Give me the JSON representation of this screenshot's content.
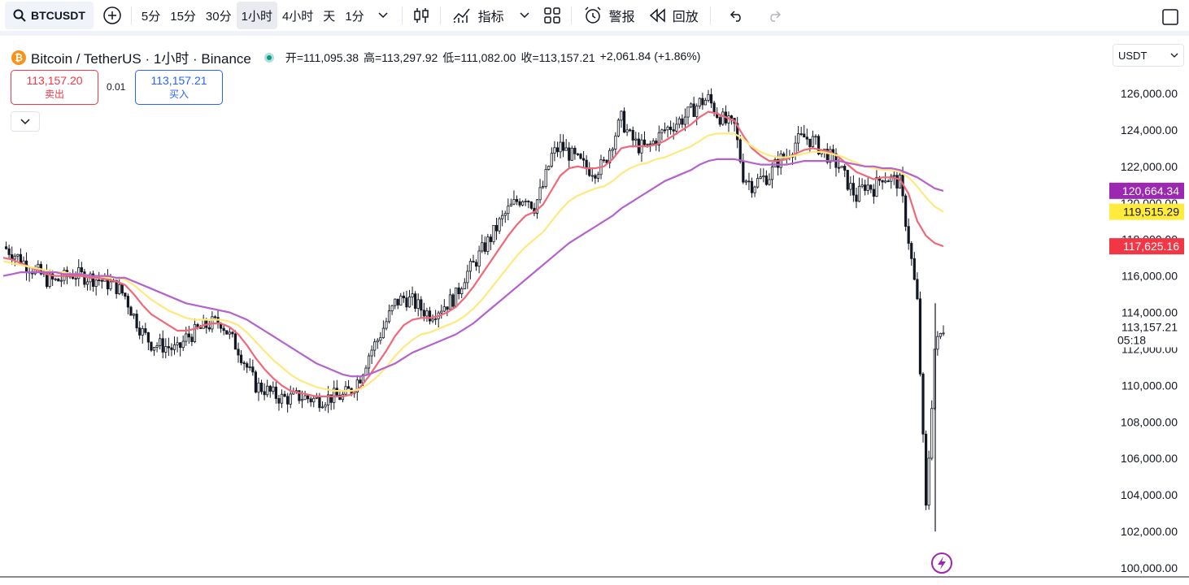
{
  "toolbar": {
    "symbol": "BTCUSDT",
    "timeframes": [
      "5分",
      "15分",
      "30分",
      "1小时",
      "4小时",
      "天",
      "1分"
    ],
    "active_timeframe": "1小时",
    "indicators_label": "指标",
    "alerts_label": "警报",
    "replay_label": "回放"
  },
  "legend": {
    "pair": "Bitcoin / TetherUS · 1小时 · Binance",
    "open_label": "开=",
    "open": "111,095.38",
    "high_label": "高=",
    "high": "113,297.92",
    "low_label": "低=",
    "low": "111,082.00",
    "close_label": "收=",
    "close": "113,157.21",
    "change": "+2,061.84 (+1.86%)"
  },
  "trade": {
    "sell_price": "113,157.20",
    "sell_label": "卖出",
    "spread": "0.01",
    "buy_price": "113,157.21",
    "buy_label": "买入"
  },
  "currency": "USDT",
  "colors": {
    "ma_fast": "#f06878",
    "ma_mid": "#ffe97f",
    "ma_slow": "#b462cc",
    "up": "#131722",
    "down": "#131722",
    "price_badge_fast": "#f23645",
    "price_badge_slow": "#9c27b0"
  },
  "chart_data": {
    "type": "line",
    "title": "Bitcoin / TetherUS · 1小时 · Binance",
    "xlabel": "",
    "ylabel": "",
    "ylim": [
      100000,
      127000
    ],
    "y_ticks": [
      "100,000.00",
      "102,000.00",
      "104,000.00",
      "106,000.00",
      "108,000.00",
      "110,000.00",
      "112,000.00",
      "114,000.00",
      "116,000.00",
      "118,000.00",
      "120,000.00",
      "122,000.00",
      "124,000.00",
      "126,000.00"
    ],
    "price_close": [
      117600,
      117300,
      116900,
      116500,
      116200,
      115800,
      115700,
      115900,
      116100,
      116000,
      115900,
      115800,
      115600,
      115400,
      114900,
      113800,
      112900,
      112300,
      112200,
      112100,
      111900,
      112600,
      112900,
      113200,
      113400,
      113500,
      112700,
      112000,
      111000,
      110000,
      109800,
      109500,
      109300,
      109300,
      109400,
      109300,
      109200,
      109300,
      109400,
      109400,
      109800,
      110500,
      111700,
      112500,
      113500,
      114500,
      114800,
      114600,
      114200,
      113900,
      114200,
      114500,
      114900,
      116000,
      116600,
      117400,
      118100,
      118900,
      119600,
      120100,
      120400,
      119800,
      120900,
      122600,
      123100,
      122700,
      122300,
      121900,
      121800,
      122100,
      123400,
      124600,
      123600,
      123100,
      123000,
      123500,
      124000,
      124300,
      124600,
      125000,
      125500,
      125700,
      124900,
      124400,
      124200,
      121500,
      121000,
      121300,
      121500,
      122300,
      122600,
      123300,
      123600,
      123400,
      122900,
      122500,
      122000,
      121100,
      120300,
      121000,
      120800,
      121500,
      121300,
      121100,
      118000,
      114500,
      103200,
      112000,
      113157
    ],
    "series": [
      {
        "name": "",
        "color": "#f06878",
        "values": [
          117000,
          116900,
          116700,
          116500,
          116300,
          116100,
          116000,
          116000,
          116000,
          116000,
          115900,
          115900,
          115800,
          115700,
          115500,
          115000,
          114400,
          113900,
          113600,
          113300,
          113000,
          113000,
          113100,
          113300,
          113400,
          113400,
          113200,
          112800,
          112200,
          111500,
          110900,
          110400,
          110000,
          109700,
          109600,
          109500,
          109400,
          109400,
          109400,
          109400,
          109500,
          109900,
          110500,
          111200,
          111900,
          112700,
          113300,
          113600,
          113700,
          113700,
          113800,
          114000,
          114300,
          114800,
          115400,
          116100,
          116800,
          117500,
          118200,
          118800,
          119300,
          119500,
          119900,
          120700,
          121500,
          121900,
          122000,
          121900,
          121900,
          122000,
          122400,
          123000,
          123100,
          123100,
          123100,
          123200,
          123400,
          123700,
          124000,
          124300,
          124700,
          125000,
          124900,
          124700,
          124500,
          123700,
          123000,
          122600,
          122300,
          122300,
          122400,
          122700,
          122900,
          123000,
          122900,
          122800,
          122500,
          122100,
          121700,
          121500,
          121300,
          121400,
          121400,
          121300,
          120500,
          119000,
          118200,
          117800,
          117625
        ]
      },
      {
        "name": "",
        "color": "#ffe97f",
        "values": [
          116800,
          116700,
          116600,
          116500,
          116400,
          116300,
          116200,
          116200,
          116100,
          116100,
          116000,
          116000,
          115900,
          115900,
          115800,
          115500,
          115100,
          114700,
          114400,
          114100,
          113900,
          113700,
          113600,
          113600,
          113600,
          113600,
          113500,
          113300,
          112900,
          112400,
          111900,
          111400,
          111000,
          110600,
          110300,
          110100,
          109900,
          109800,
          109700,
          109700,
          109700,
          109800,
          110100,
          110500,
          111000,
          111600,
          112100,
          112500,
          112800,
          112900,
          113100,
          113300,
          113500,
          113800,
          114200,
          114700,
          115300,
          115900,
          116500,
          117100,
          117600,
          118000,
          118400,
          119000,
          119600,
          120100,
          120400,
          120600,
          120800,
          120900,
          121200,
          121600,
          121900,
          122100,
          122200,
          122400,
          122500,
          122700,
          122900,
          123100,
          123400,
          123700,
          123800,
          123800,
          123800,
          123500,
          123100,
          122800,
          122600,
          122500,
          122500,
          122600,
          122700,
          122800,
          122800,
          122700,
          122600,
          122400,
          122200,
          122000,
          121900,
          121800,
          121800,
          121700,
          121400,
          120900,
          120300,
          119800,
          119515
        ]
      },
      {
        "name": "",
        "color": "#b462cc",
        "values": [
          116000,
          116100,
          116200,
          116200,
          116200,
          116200,
          116200,
          116100,
          116100,
          116100,
          116000,
          116000,
          116000,
          115900,
          115900,
          115700,
          115500,
          115300,
          115100,
          114900,
          114700,
          114500,
          114400,
          114300,
          114200,
          114100,
          114000,
          113800,
          113600,
          113300,
          113000,
          112700,
          112400,
          112100,
          111800,
          111500,
          111200,
          111000,
          110800,
          110600,
          110500,
          110500,
          110600,
          110800,
          111000,
          111200,
          111500,
          111800,
          112000,
          112200,
          112400,
          112600,
          112800,
          113100,
          113400,
          113800,
          114200,
          114600,
          115000,
          115400,
          115800,
          116200,
          116600,
          117000,
          117400,
          117800,
          118100,
          118400,
          118700,
          119000,
          119300,
          119700,
          120000,
          120300,
          120600,
          120900,
          121200,
          121400,
          121600,
          121800,
          122100,
          122300,
          122400,
          122400,
          122400,
          122300,
          122200,
          122100,
          122100,
          122100,
          122100,
          122200,
          122300,
          122300,
          122300,
          122300,
          122300,
          122200,
          122100,
          122000,
          122000,
          121900,
          121900,
          121800,
          121600,
          121400,
          121100,
          120800,
          120664
        ]
      }
    ],
    "badges": [
      {
        "value": "120,664.34",
        "price": 120664.34,
        "bg": "#9c27b0",
        "fg": "#ffffff"
      },
      {
        "value": "119,515.29",
        "price": 119515.29,
        "bg": "#ffeb3b",
        "fg": "#131722"
      },
      {
        "value": "117,625.16",
        "price": 117625.16,
        "bg": "#f23645",
        "fg": "#ffffff"
      }
    ],
    "last_price": {
      "value": "113,157.21",
      "countdown": "05:18",
      "price": 113157.21
    },
    "low_wick": 102000
  }
}
